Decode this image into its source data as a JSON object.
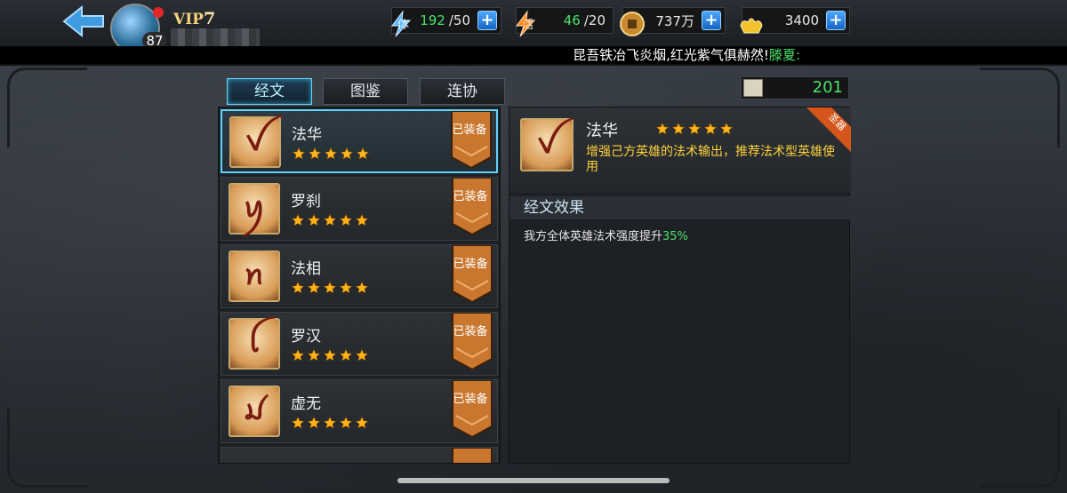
{
  "topbar": {
    "level": "87",
    "vip_label": "VIP",
    "vip_level": "7",
    "stamina_label": "体",
    "stamina_current": "192",
    "stamina_max": "/50",
    "vigor_label": "活",
    "vigor_current": "46",
    "vigor_max": "/20",
    "copper": "737万",
    "gold": "3400",
    "plus_symbol": "+"
  },
  "marquee": {
    "text": "昆吾铁冶飞炎烟,红光紫气俱赫然!",
    "highlight": "滕夏:"
  },
  "tabs": [
    {
      "label": "经文",
      "active": true
    },
    {
      "label": "图鉴",
      "active": false
    },
    {
      "label": "连协",
      "active": false
    }
  ],
  "count": "201",
  "list": [
    {
      "name": "法华",
      "glyph": "ꪜ",
      "stars": 5,
      "status": "已装备",
      "selected": true
    },
    {
      "name": "罗刹",
      "glyph": "ꪗ",
      "stars": 5,
      "status": "已装备",
      "selected": false
    },
    {
      "name": "法相",
      "glyph": "ꪀ",
      "stars": 5,
      "status": "已装备",
      "selected": false
    },
    {
      "name": "罗汉",
      "glyph": "ꪶ",
      "stars": 5,
      "status": "已装备",
      "selected": false
    },
    {
      "name": "虚无",
      "glyph": "ꪣ",
      "stars": 5,
      "status": "已装备",
      "selected": false
    }
  ],
  "detail": {
    "name": "法华",
    "stars": 5,
    "corner_tag": "圣器",
    "description": "增强己方英雄的法术输出，推荐法术型英雄使用",
    "section_title": "经文效果",
    "effect_text": "我方全体英雄法术强度提升",
    "effect_value": "35%"
  },
  "colors": {
    "accent_cyan": "#5fd4ff",
    "value_green": "#4be36a",
    "desc_yellow": "#ffd23a",
    "ribbon_orange": "#c9772f",
    "star_gold": "#ffb21a"
  }
}
